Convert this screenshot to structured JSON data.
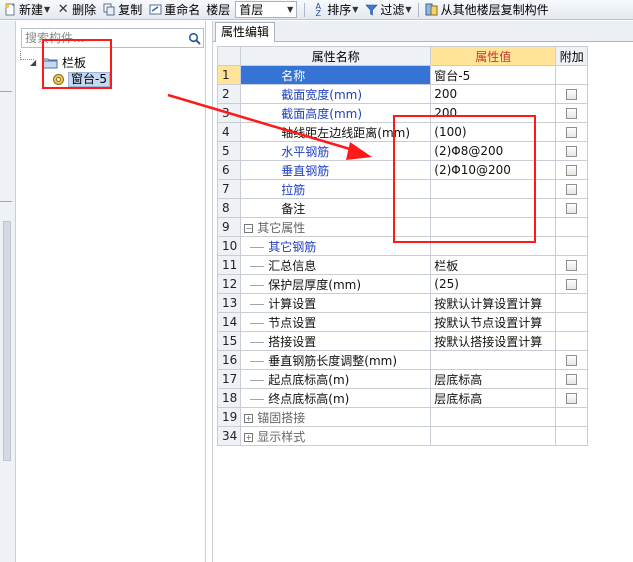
{
  "toolbar": {
    "new_label": "新建",
    "delete_label": "删除",
    "copy_label": "复制",
    "rename_label": "重命名",
    "floor_label": "楼层",
    "floor_value": "首层",
    "sort_label": "排序",
    "filter_label": "过滤",
    "copy_from_floor_label": "从其他楼层复制构件"
  },
  "search": {
    "placeholder": "搜索构件..."
  },
  "tree": {
    "root_label": "栏板",
    "child_label": "窗台-5"
  },
  "tab": {
    "label": "属性编辑"
  },
  "grid": {
    "headers": {
      "name": "属性名称",
      "value": "属性值",
      "extra": "附加"
    },
    "rows": [
      {
        "num": "1",
        "name": "名称",
        "value": "窗台-5",
        "style": "sel",
        "checkbox": false
      },
      {
        "num": "2",
        "name": "截面宽度(mm)",
        "value": "200",
        "style": "blue",
        "checkbox": true
      },
      {
        "num": "3",
        "name": "截面高度(mm)",
        "value": "200",
        "style": "blue",
        "checkbox": true
      },
      {
        "num": "4",
        "name": "轴线距左边线距离(mm)",
        "value": "(100)",
        "style": "black",
        "checkbox": true
      },
      {
        "num": "5",
        "name": "水平钢筋",
        "value": "(2)Φ8@200",
        "style": "blue",
        "checkbox": true
      },
      {
        "num": "6",
        "name": "垂直钢筋",
        "value": "(2)Φ10@200",
        "style": "blue",
        "checkbox": true
      },
      {
        "num": "7",
        "name": "拉筋",
        "value": "",
        "style": "blue",
        "checkbox": true
      },
      {
        "num": "8",
        "name": "备注",
        "value": "",
        "style": "black",
        "checkbox": true
      },
      {
        "num": "9",
        "name": "其它属性",
        "value": "",
        "style": "group-minus",
        "checkbox": false
      },
      {
        "num": "10",
        "name": "其它钢筋",
        "value": "",
        "style": "child-blue",
        "checkbox": false
      },
      {
        "num": "11",
        "name": "汇总信息",
        "value": "栏板",
        "style": "child-black",
        "checkbox": true
      },
      {
        "num": "12",
        "name": "保护层厚度(mm)",
        "value": "(25)",
        "style": "child-black",
        "checkbox": true
      },
      {
        "num": "13",
        "name": "计算设置",
        "value": "按默认计算设置计算",
        "style": "child-black",
        "checkbox": false
      },
      {
        "num": "14",
        "name": "节点设置",
        "value": "按默认节点设置计算",
        "style": "child-black",
        "checkbox": false
      },
      {
        "num": "15",
        "name": "搭接设置",
        "value": "按默认搭接设置计算",
        "style": "child-black",
        "checkbox": false
      },
      {
        "num": "16",
        "name": "垂直钢筋长度调整(mm)",
        "value": "",
        "style": "child-black",
        "checkbox": true
      },
      {
        "num": "17",
        "name": "起点底标高(m)",
        "value": "层底标高",
        "style": "child-black",
        "checkbox": true
      },
      {
        "num": "18",
        "name": "终点底标高(m)",
        "value": "层底标高",
        "style": "child-black",
        "checkbox": true
      },
      {
        "num": "19",
        "name": "锚固搭接",
        "value": "",
        "style": "group-plus",
        "checkbox": false
      },
      {
        "num": "34",
        "name": "显示样式",
        "value": "",
        "style": "group-plus",
        "checkbox": false
      }
    ]
  },
  "colors": {
    "annotation_red": "#ff1a1a",
    "selected_name_bg": "#3574d4",
    "value_header_bg": "#ffe49a",
    "property_blue": "#1f3fbf"
  }
}
